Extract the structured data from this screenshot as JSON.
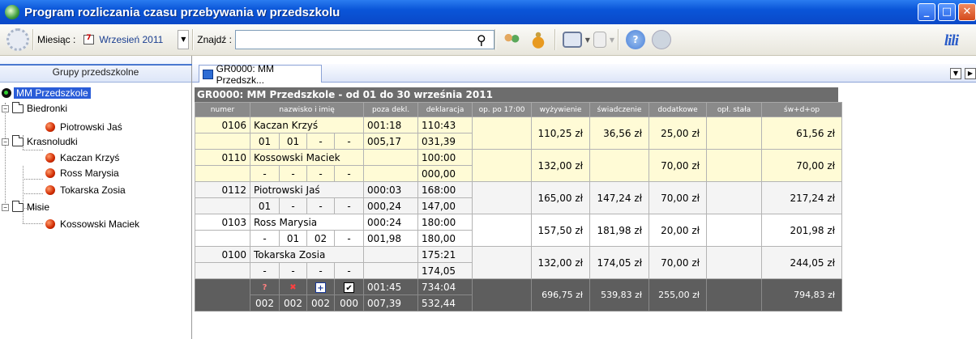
{
  "window": {
    "title": "Program rozliczania czasu przebywania w przedszkolu"
  },
  "toolbar": {
    "month_label": "Miesiąc :",
    "month_value": "Wrzesień 2011",
    "search_label": "Znajdź :",
    "search_value": "",
    "logo": "lili",
    "icons": [
      "settings-icon",
      "calendar-icon",
      "dropdown-arrow-icon",
      "search-icon",
      "users-icon",
      "money-bag-icon",
      "printer-icon",
      "export-icon",
      "help-icon",
      "exit-icon"
    ]
  },
  "sidebar": {
    "header": "Grupy przedszkolne",
    "root": "MM Przedszkole",
    "groups": [
      {
        "name": "Biedronki",
        "children": [
          "Piotrowski Jaś"
        ]
      },
      {
        "name": "Krasnoludki",
        "children": [
          "Kaczan Krzyś",
          "Ross Marysia",
          "Tokarska Zosia"
        ]
      },
      {
        "name": "Misie",
        "children": [
          "Kossowski Maciek"
        ]
      }
    ]
  },
  "tab": {
    "label": "GR0000: MM Przedszk..."
  },
  "grid": {
    "title": "GR0000: MM Przedszkole - od 01 do 30 września 2011",
    "headers": [
      "numer",
      "nazwisko i imię",
      "poza dekl.",
      "deklaracja",
      "op. po 17:00",
      "wyżywienie",
      "świadczenie",
      "dodatkowe",
      "opł. stała",
      "św+d+op"
    ],
    "rows": [
      {
        "numer": "0106",
        "name": "Kaczan Krzyś",
        "poza": "001:18",
        "dekl": "110:43",
        "sub": [
          "01",
          "01",
          "-",
          "-"
        ],
        "poza2": "005,17",
        "dekl2": "031,39",
        "op": "",
        "wyz": "110,25 zł",
        "swiad": "36,56 zł",
        "dod": "25,00 zł",
        "opl": "",
        "sum": "61,56 zł",
        "style": "yellow"
      },
      {
        "numer": "0110",
        "name": "Kossowski Maciek",
        "poza": "",
        "dekl": "100:00",
        "sub": [
          "-",
          "-",
          "-",
          "-"
        ],
        "poza2": "",
        "dekl2": "000,00",
        "op": "",
        "wyz": "132,00 zł",
        "swiad": "",
        "dod": "70,00 zł",
        "opl": "",
        "sum": "70,00 zł",
        "style": "yellow"
      },
      {
        "numer": "0112",
        "name": "Piotrowski Jaś",
        "poza": "000:03",
        "dekl": "168:00",
        "sub": [
          "01",
          "-",
          "-",
          "-"
        ],
        "poza2": "000,24",
        "dekl2": "147,00",
        "op": "",
        "wyz": "165,00 zł",
        "swiad": "147,24 zł",
        "dod": "70,00 zł",
        "opl": "",
        "sum": "217,24 zł",
        "style": "gray"
      },
      {
        "numer": "0103",
        "name": "Ross Marysia",
        "poza": "000:24",
        "dekl": "180:00",
        "sub": [
          "-",
          "01",
          "02",
          "-"
        ],
        "poza2": "001,98",
        "dekl2": "180,00",
        "op": "",
        "wyz": "157,50 zł",
        "swiad": "181,98 zł",
        "dod": "20,00 zł",
        "opl": "",
        "sum": "201,98 zł",
        "style": "white"
      },
      {
        "numer": "0100",
        "name": "Tokarska Zosia",
        "poza": "",
        "dekl": "175:21",
        "sub": [
          "-",
          "-",
          "-",
          "-"
        ],
        "poza2": "",
        "dekl2": "174,05",
        "op": "",
        "wyz": "132,00 zł",
        "swiad": "174,05 zł",
        "dod": "70,00 zł",
        "opl": "",
        "sum": "244,05 zł",
        "style": "gray"
      }
    ],
    "footer": {
      "icons": [
        "question-icon",
        "delete-icon",
        "plus-icon",
        "check-icon"
      ],
      "counts": [
        "002",
        "002",
        "002",
        "000"
      ],
      "poza": "001:45",
      "dekl": "734:04",
      "poza2": "007,39",
      "dekl2": "532,44",
      "wyz": "696,75 zł",
      "swiad": "539,83 zł",
      "dod": "255,00 zł",
      "opl": "",
      "sum": "794,83 zł"
    }
  }
}
